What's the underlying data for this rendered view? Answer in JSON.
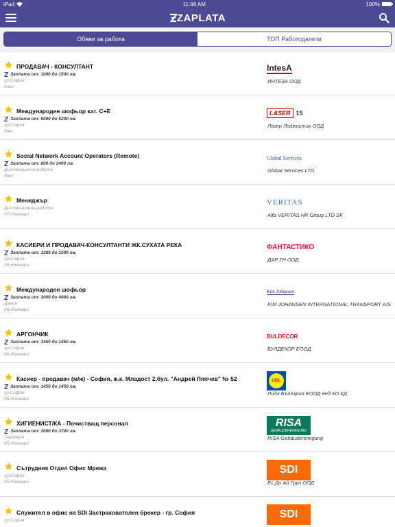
{
  "status": {
    "carrier": "iPad",
    "time": "11:48 AM",
    "battery": "100%",
    "battery_level": 1.0
  },
  "nav": {
    "logo": "ZAPLATA",
    "menu_icon": "hamburger-menu-icon",
    "search_icon": "search-icon"
  },
  "tabs": [
    {
      "label": "Обяви за работа",
      "active": true
    },
    {
      "label": "ТОП Работодатели",
      "active": false
    }
  ],
  "colors": {
    "primary": "#4a4a95",
    "star": "#f2c200"
  },
  "jobs": [
    {
      "title": "ПРОДАВАЧ - КОНСУЛТАНТ",
      "salary": "Заплата от: 1000 до 1500 лв.",
      "location": "гр.София",
      "date": "днес",
      "logo_text": "IntesA",
      "logo_sub": "",
      "company": "ИНТЕЗА ООД"
    },
    {
      "title": "Международен шофьор кат. C+E",
      "salary": "Заплата от: 5000 до 5200 лв.",
      "location": "гр.София",
      "date": "днес",
      "logo_text": "LASER",
      "logo_sub": "15",
      "company": "Лазер Лоджистик ООД"
    },
    {
      "title": "Social Network Account Operators (Remote)",
      "salary": "Заплата от: 800 до 2400 лв.",
      "location": "Дистанционна работа",
      "date": "днес",
      "logo_text": "Global Services",
      "logo_sub": "",
      "company": "Global Services LTD"
    },
    {
      "title": "Мениджър",
      "salary": "",
      "location": "Дистанционна работа",
      "date": "07.Ноември",
      "logo_text": "VERITAS",
      "logo_sub": "",
      "company": "Alfa VERITAS HR Group LTD SK"
    },
    {
      "title": "КАСИЕРИ И ПРОДАВАЧ-КОНСУЛТАНТИ ЖК.СУХАТА РЕКА",
      "salary": "Заплата от: 1260 до 1500 лв.",
      "location": "гр.София",
      "date": "06.Ноември",
      "logo_text": "ФАНТАСТИКО",
      "logo_sub": "",
      "company": "ДАР ГН ООД"
    },
    {
      "title": "Международен шофьор",
      "salary": "Заплата от: 3000 до 4000 лв.",
      "location": "Дания",
      "date": "06.Ноември",
      "logo_text": "Kim Johansen",
      "logo_sub": "",
      "company": "KIM JOHANSEN INTERNATIONAL TRANSPORT A/S"
    },
    {
      "title": "АРГОНЧИК",
      "salary": "Заплата от: 1450 до 1450 лв.",
      "location": "гр.София",
      "date": "06.Ноември",
      "logo_text": "BULDECOR",
      "logo_sub": "",
      "company": "БУЛДЕКОР ЕООД"
    },
    {
      "title": "Касиер - продавач (м/ж) - София, ж.к. Младост 2,бул. \"Андрей Ляпчев\" № 52",
      "salary": "Заплата от: 1450 до 1450 лв.",
      "location": "гр.София",
      "date": "06.Ноември",
      "logo_text": "LIDL",
      "logo_sub": "",
      "company": "Лидл България ЕООД енд КО.КД"
    },
    {
      "title": "ХИГИЕНИСТ/КА - Почистващ персонал",
      "salary": "Заплата от: 3000 до 3700 лв.",
      "location": "Германия",
      "date": "05.Ноември",
      "logo_text": "RISA",
      "logo_sub": "GEBÄUDEREINIGUNG",
      "company": "RISA Gebäudereinigung"
    },
    {
      "title": "Сътрудник Отдел Офис Мрежа",
      "salary": "",
      "location": "гр.София",
      "date": "05.Ноември",
      "logo_text": "SDI",
      "logo_sub": "",
      "company": "Ес Ди Ай Груп ООД"
    },
    {
      "title": "Служител в офис на SDI Застрахователен брокер - гр. София",
      "salary": "",
      "location": "гр.София",
      "date": "",
      "logo_text": "SDI",
      "logo_sub": "",
      "company": ""
    }
  ]
}
